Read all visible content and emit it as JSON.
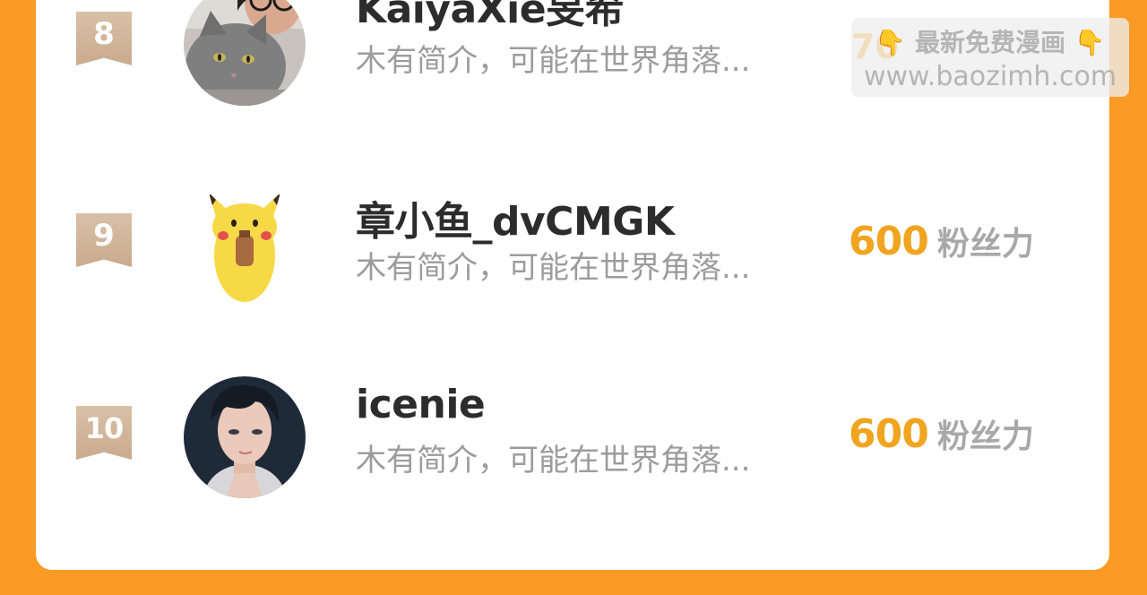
{
  "ranking": [
    {
      "rank": "8",
      "name": "KaiyaXie旻希",
      "bio": "木有简介，可能在世界角落...",
      "fans_value": "",
      "fans_unit": "",
      "avatar": "cat-selfie-avatar"
    },
    {
      "rank": "9",
      "name": "章小鱼_dvCMGK",
      "bio": "木有简介，可能在世界角落...",
      "fans_value": "600",
      "fans_unit": "粉丝力",
      "avatar": "pikachu-avatar"
    },
    {
      "rank": "10",
      "name": "icenie",
      "bio": "木有简介，可能在世界角落...",
      "fans_value": "600",
      "fans_unit": "粉丝力",
      "avatar": "anime-man-avatar"
    }
  ],
  "watermark": {
    "line1": "最新免费漫画",
    "line2": "www.baozimh.com",
    "hand_icon": "pointing-down-hand-icon",
    "ghost": "70"
  },
  "colors": {
    "background": "#fb9b25",
    "card": "#ffffff",
    "name": "#2c2c2c",
    "bio": "#9c9c9c",
    "fans_value": "#f0a41f",
    "fans_unit": "#a8a8a8",
    "rank_badge": "#cfb497"
  }
}
